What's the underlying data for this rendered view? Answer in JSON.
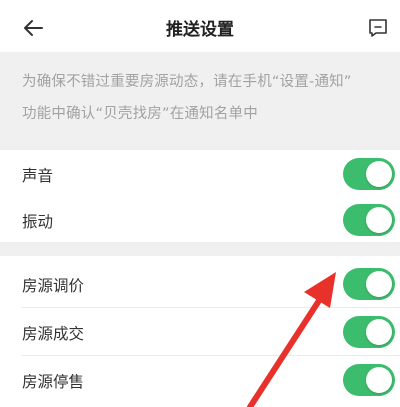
{
  "header": {
    "title": "推送设置",
    "back_icon": "back-arrow-icon",
    "feedback_icon": "feedback-icon"
  },
  "notice": {
    "line1": "为确保不错过重要房源动态，请在手机“设置-通知”",
    "line2": "功能中确认“贝壳找房”在通知名单中"
  },
  "section1": [
    {
      "label": "声音",
      "enabled": true
    },
    {
      "label": "振动",
      "enabled": true
    }
  ],
  "section2": [
    {
      "label": "房源调价",
      "enabled": true
    },
    {
      "label": "房源成交",
      "enabled": true
    },
    {
      "label": "房源停售",
      "enabled": true
    }
  ],
  "colors": {
    "toggle_on": "#3cbd6d",
    "annotation_arrow": "#e8312b"
  }
}
